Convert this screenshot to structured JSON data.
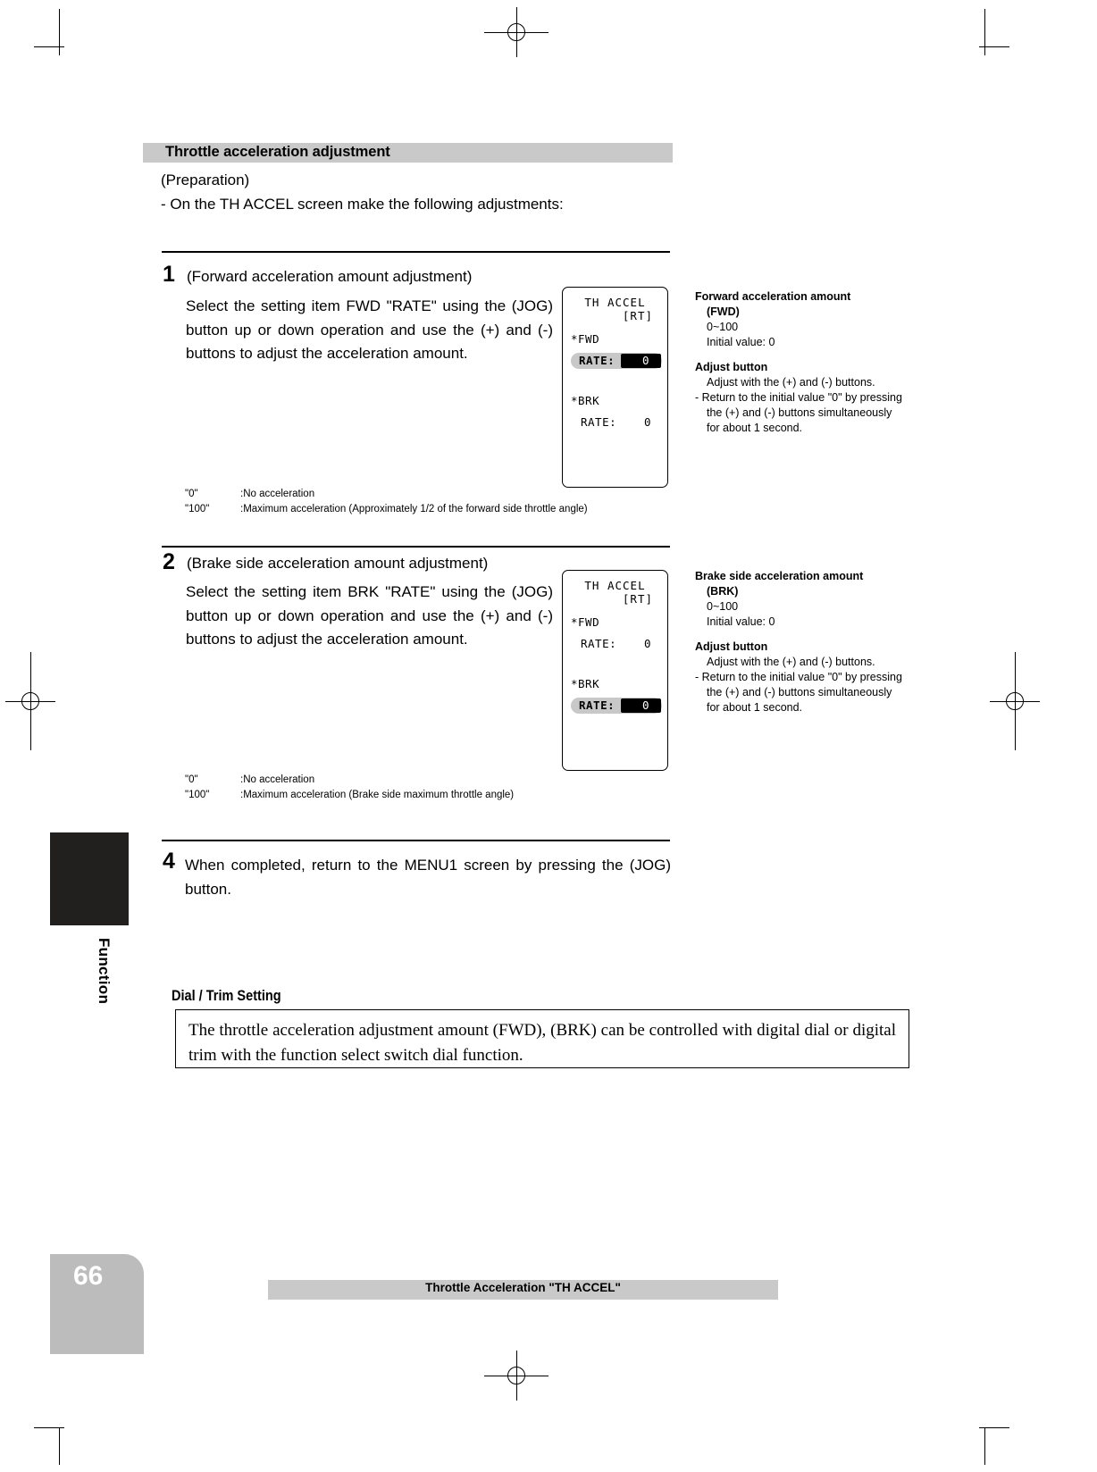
{
  "section": {
    "heading": "Throttle acceleration adjustment",
    "preparation_label": "(Preparation)",
    "preparation_line": "- On the TH ACCEL screen make the following adjustments:"
  },
  "steps": [
    {
      "number": "1",
      "title": "(Forward acceleration amount adjustment)",
      "body": "Select the setting item FWD \"RATE\" using the (JOG) button up or down operation and use the (+) and (-) buttons to adjust the acceleration amount.",
      "footnotes": [
        {
          "key": "\"0\"",
          "value": ":No acceleration"
        },
        {
          "key": "\"100\"",
          "value": ":Maximum acceleration (Approximately 1/2 of the forward side throttle angle)"
        }
      ],
      "lcd": {
        "title": "TH ACCEL",
        "subtitle": "[RT]",
        "group1_label": "*FWD",
        "group1_rate_label": "RATE:",
        "group1_rate_value": "0",
        "group1_selected": true,
        "group2_label": "*BRK",
        "group2_rate_label": "RATE:",
        "group2_rate_value": "0",
        "group2_selected": false
      },
      "sidebar": {
        "title_line1": "Forward acceleration amount",
        "title_line2": "(FWD)",
        "range": "0~100",
        "initial": "Initial value: 0",
        "adjust_title": "Adjust button",
        "adjust_text": "Adjust with the (+) and (-) buttons.",
        "reset_text": "- Return to the initial value \"0\" by pressing the (+) and (-) buttons simultaneously for about 1 second."
      }
    },
    {
      "number": "2",
      "title": "(Brake side acceleration amount adjustment)",
      "body": "Select the setting item BRK \"RATE\" using the (JOG) button up or down operation and use the (+) and (-) buttons to adjust the acceleration amount.",
      "footnotes": [
        {
          "key": "\"0\"",
          "value": ":No acceleration"
        },
        {
          "key": "\"100\"",
          "value": ":Maximum acceleration (Brake side maximum throttle angle)"
        }
      ],
      "lcd": {
        "title": "TH ACCEL",
        "subtitle": "[RT]",
        "group1_label": "*FWD",
        "group1_rate_label": "RATE:",
        "group1_rate_value": "0",
        "group1_selected": false,
        "group2_label": "*BRK",
        "group2_rate_label": "RATE:",
        "group2_rate_value": "0",
        "group2_selected": true
      },
      "sidebar": {
        "title_line1": "Brake side acceleration amount",
        "title_line2": "(BRK)",
        "range": "0~100",
        "initial": "Initial value: 0",
        "adjust_title": "Adjust button",
        "adjust_text": "Adjust with the (+) and (-) buttons.",
        "reset_text": "- Return to the initial value \"0\" by pressing the (+) and (-) buttons simultaneously for about 1 second."
      }
    }
  ],
  "final_step": {
    "number": "4",
    "body": "When completed, return to the MENU1 screen by pressing the (JOG) button."
  },
  "dial_trim": {
    "title": "Dial / Trim Setting",
    "body": "The throttle acceleration adjustment amount (FWD), (BRK) can be controlled with digital dial or digital trim with the function select switch dial function."
  },
  "side_tab": {
    "label": "Function"
  },
  "footer": {
    "page_number": "66",
    "title": "Throttle Acceleration  \"TH ACCEL\""
  }
}
